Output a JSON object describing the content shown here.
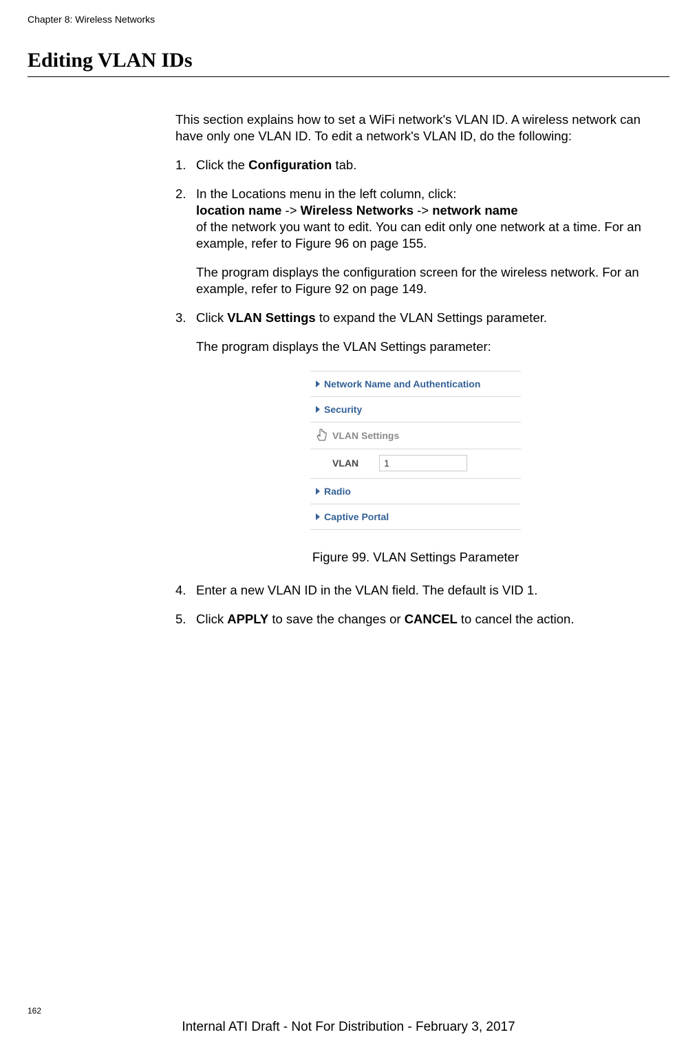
{
  "header": {
    "chapter": "Chapter 8: Wireless Networks"
  },
  "title": "Editing VLAN IDs",
  "intro": "This section explains how to set a WiFi network's VLAN ID. A wireless network can have only one VLAN ID. To edit a network's VLAN ID, do the following:",
  "steps": {
    "s1": {
      "num": "1.",
      "pre": "Click the ",
      "bold": "Configuration",
      "post": " tab."
    },
    "s2": {
      "num": "2.",
      "line1": "In the Locations menu in the left column, click:",
      "loc_label": "location name",
      "arrow1": " -> ",
      "wn": "Wireless Networks",
      "arrow2": " -> ",
      "nn": "network name",
      "line2": "of the network you want to edit. You can edit only one network at a time. For an example, refer to Figure 96 on page 155.",
      "sub": "The program displays the configuration screen for the wireless network. For an example, refer to Figure 92 on page 149."
    },
    "s3": {
      "num": "3.",
      "pre": "Click ",
      "bold": "VLAN Settings",
      "post": " to expand the VLAN Settings parameter.",
      "sub": "The program displays the VLAN Settings parameter:"
    },
    "s4": {
      "num": "4.",
      "text": "Enter a new VLAN ID in the VLAN field. The default is VID 1."
    },
    "s5": {
      "num": "5.",
      "pre": "Click ",
      "b1": "APPLY",
      "mid": " to save the changes or ",
      "b2": "CANCEL",
      "post": " to cancel the action."
    }
  },
  "panel": {
    "item1": "Network Name and Authentication",
    "item2": "Security",
    "item3": "VLAN Settings",
    "vlan_label": "VLAN",
    "vlan_value": "1",
    "item4": "Radio",
    "item5": "Captive Portal"
  },
  "figure_caption": "Figure 99. VLAN Settings Parameter",
  "page_number": "162",
  "footer": "Internal ATI Draft - Not For Distribution - February 3, 2017"
}
